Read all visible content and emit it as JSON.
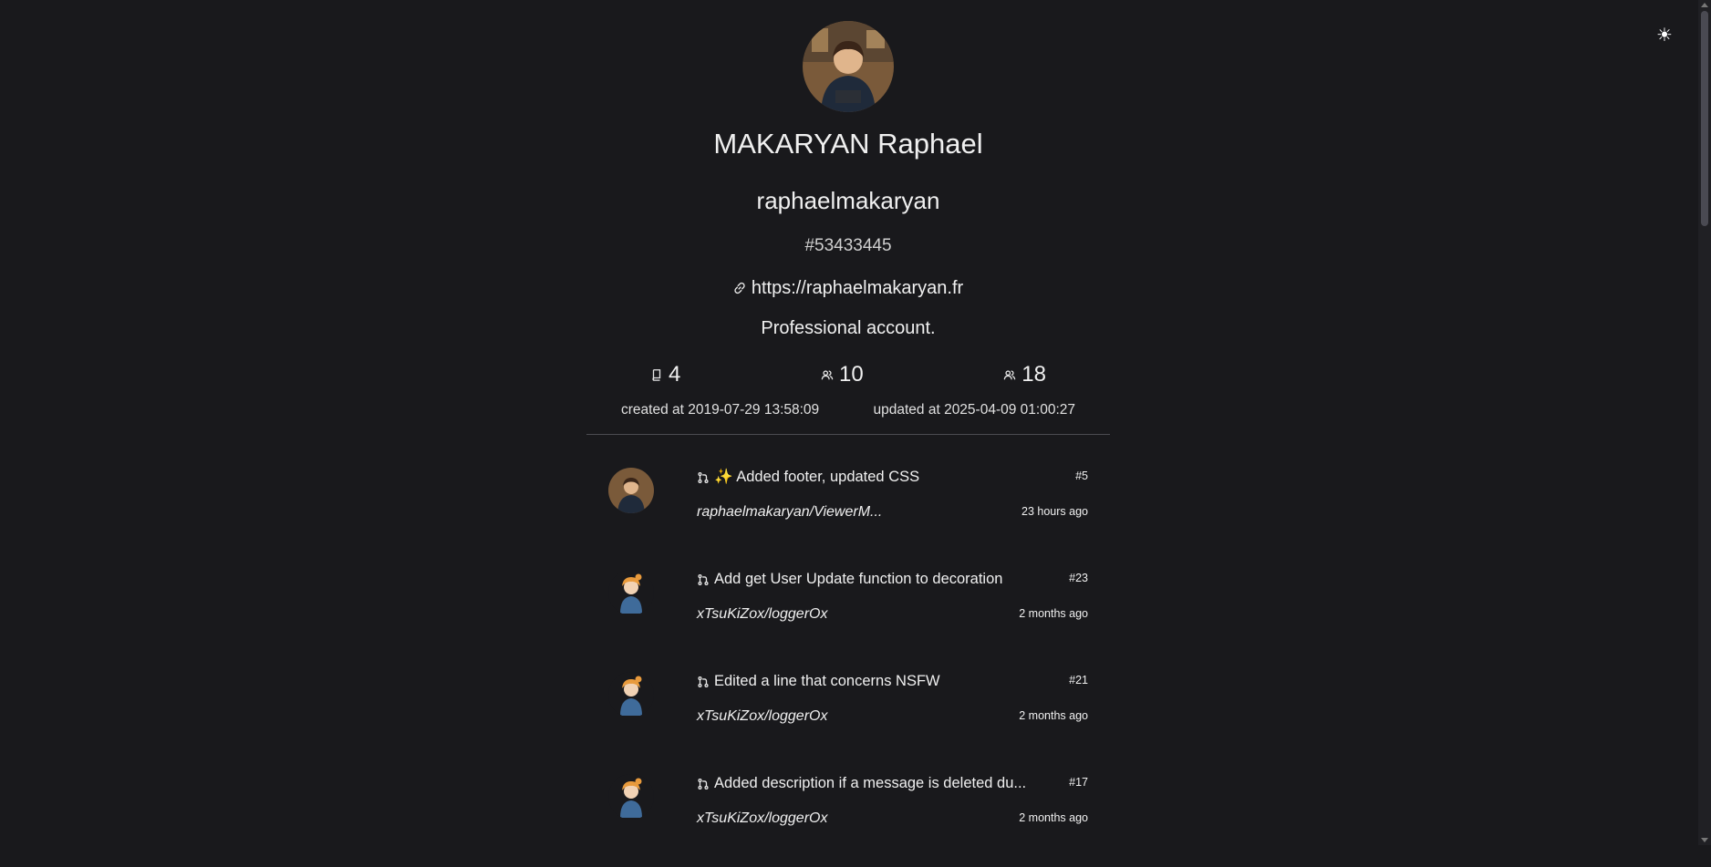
{
  "profile": {
    "fullname": "MAKARYAN Raphael",
    "login": "raphaelmakaryan",
    "id": "#53433445",
    "website": "https://raphaelmakaryan.fr",
    "bio": "Professional account.",
    "stats": {
      "repos": "4",
      "followers": "10",
      "following": "18"
    },
    "created": "created at 2019-07-29 13:58:09",
    "updated": "updated at 2025-04-09 01:00:27"
  },
  "theme_toggle_icon": "sun-icon",
  "pull_requests": [
    {
      "title": "✨ Added footer, updated CSS",
      "number": "#5",
      "repo": "raphaelmakaryan/ViewerM...",
      "time": "23 hours ago",
      "avatar": "raphael"
    },
    {
      "title": "Add get User Update function to decoration",
      "number": "#23",
      "repo": "xTsuKiZox/loggerOx",
      "time": "2 months ago",
      "avatar": "anime"
    },
    {
      "title": "Edited a line that concerns NSFW",
      "number": "#21",
      "repo": "xTsuKiZox/loggerOx",
      "time": "2 months ago",
      "avatar": "anime"
    },
    {
      "title": "Added description if a message is deleted du...",
      "number": "#17",
      "repo": "xTsuKiZox/loggerOx",
      "time": "2 months ago",
      "avatar": "anime"
    }
  ],
  "colors": {
    "background": "#19191c",
    "text": "#e6e6e6",
    "divider": "#4b4b50"
  }
}
